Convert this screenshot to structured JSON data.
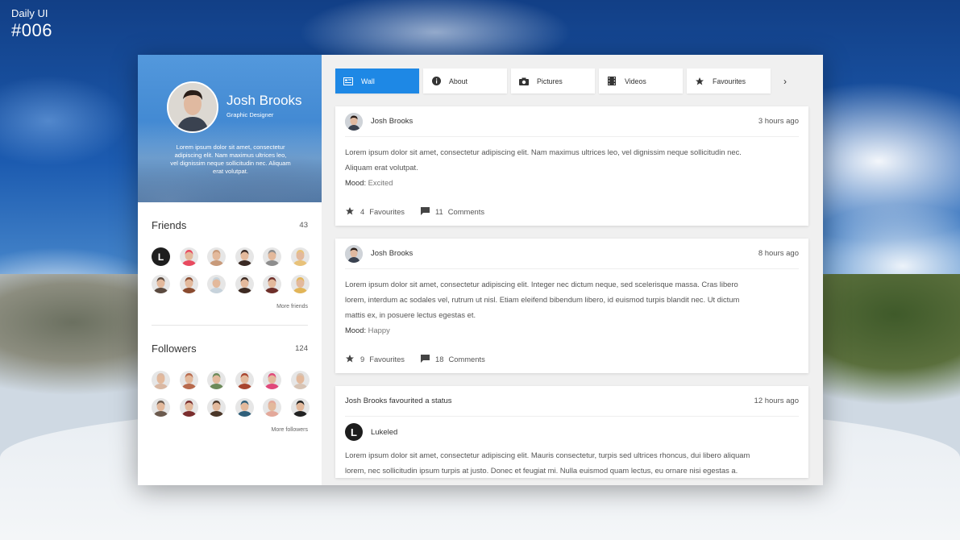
{
  "brand": {
    "line1": "Daily UI",
    "line2": "#006"
  },
  "profile": {
    "name": "Josh Brooks",
    "role": "Graphic Designer",
    "bio": "Lorem ipsum dolor sit amet, consectetur adipiscing elit. Nam maximus ultrices leo, vel dignissim neque sollicitudin nec. Aliquam erat volutpat."
  },
  "friends": {
    "title": "Friends",
    "count": "43",
    "more": "More friends",
    "first_initial": "L",
    "avatars": [
      "#1e1e1e",
      "#e84a5f",
      "#c89a7a",
      "#3a2a24",
      "#8d8d8d",
      "#e8c27a",
      "#5b4a3f",
      "#8a4b2f",
      "#c7d3dc",
      "#3d2a22",
      "#6e2f2a",
      "#e2b558"
    ]
  },
  "followers": {
    "title": "Followers",
    "count": "124",
    "more": "More followers",
    "avatars": [
      "#d9b8a3",
      "#b86a4d",
      "#6c8a5a",
      "#a8452f",
      "#e0487a",
      "#d7c4b5",
      "#6b5a4e",
      "#7a2d2d",
      "#4a3628",
      "#2f5f7a",
      "#e3a89a",
      "#222222"
    ]
  },
  "tabs": [
    {
      "label": "Wall",
      "icon": "wall-icon",
      "active": true
    },
    {
      "label": "About",
      "icon": "info-icon"
    },
    {
      "label": "Pictures",
      "icon": "camera-icon"
    },
    {
      "label": "Videos",
      "icon": "film-icon"
    },
    {
      "label": "Favourites",
      "icon": "star-icon"
    }
  ],
  "posts": [
    {
      "author": "Josh Brooks",
      "time": "3 hours ago",
      "text": "Lorem ipsum dolor sit amet, consectetur adipiscing elit. Nam maximus ultrices leo, vel dignissim neque sollicitudin nec. Aliquam erat volutpat.",
      "mood_label": "Mood:",
      "mood": "Excited",
      "favs": "4",
      "favs_label": "Favourites",
      "comments": "11",
      "comments_label": "Comments"
    },
    {
      "author": "Josh Brooks",
      "time": "8 hours ago",
      "text": "Lorem ipsum dolor sit amet, consectetur adipiscing elit. Integer nec dictum neque, sed scelerisque massa. Cras libero lorem, interdum ac sodales vel, rutrum ut nisl. Etiam eleifend bibendum libero, id euismod turpis blandit nec. Ut dictum mattis ex, in posuere lectus egestas et.",
      "mood_label": "Mood:",
      "mood": "Happy",
      "favs": "9",
      "favs_label": "Favourites",
      "comments": "18",
      "comments_label": "Comments"
    }
  ],
  "activity": {
    "title": "Josh Brooks favourited a status",
    "time": "12 hours ago",
    "user": "Lukeled",
    "user_initial": "L",
    "text": "Lorem ipsum dolor sit amet, consectetur adipiscing elit. Mauris consectetur, turpis sed ultrices rhoncus, dui libero aliquam lorem, nec sollicitudin ipsum turpis at justo. Donec et feugiat mi. Nulla euismod quam lectus, eu ornare nisi egestas a."
  }
}
